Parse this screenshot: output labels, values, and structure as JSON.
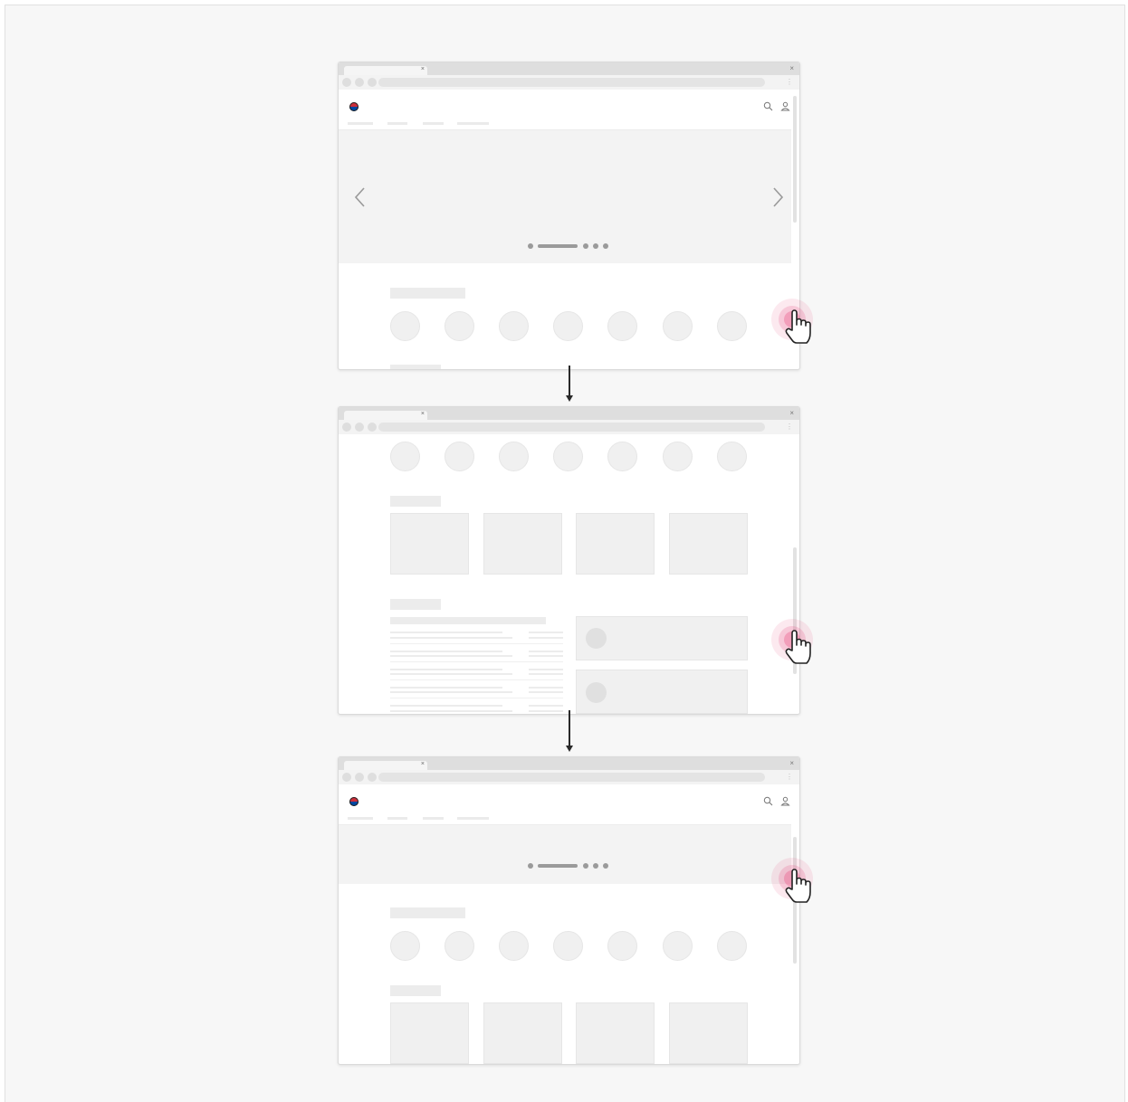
{
  "diagram": {
    "kind": "scroll-flow",
    "steps": [
      {
        "screen": "top-of-page",
        "hero_visible": true,
        "carousel": {
          "page_count": 5,
          "active_page": 2
        }
      },
      {
        "screen": "scrolled-mid-page",
        "hero_visible": false
      },
      {
        "screen": "scrolled-back-to-top",
        "hero_visible": true,
        "carousel": {
          "page_count": 5,
          "active_page": 2
        }
      }
    ],
    "transitions": [
      {
        "from": 1,
        "to": 2,
        "type": "arrow-down"
      },
      {
        "from": 2,
        "to": 3,
        "type": "arrow-down"
      }
    ]
  },
  "browser": {
    "tab_close_glyph": "×",
    "window_close_glyph": "×",
    "menu_glyph": "⋮"
  },
  "icons": {
    "logo": "korean-government-emblem-icon",
    "search": "search-icon",
    "user": "user-icon",
    "prev": "chevron-left-icon",
    "next": "chevron-right-icon",
    "gesture": "hand-pointer-tap-icon"
  },
  "colors": {
    "canvas": "#f7f7f7",
    "placeholder": "#ececec",
    "hero": "#f3f3f3",
    "arrow": "#2a2a2a",
    "tap_highlight": "#e8467c"
  }
}
